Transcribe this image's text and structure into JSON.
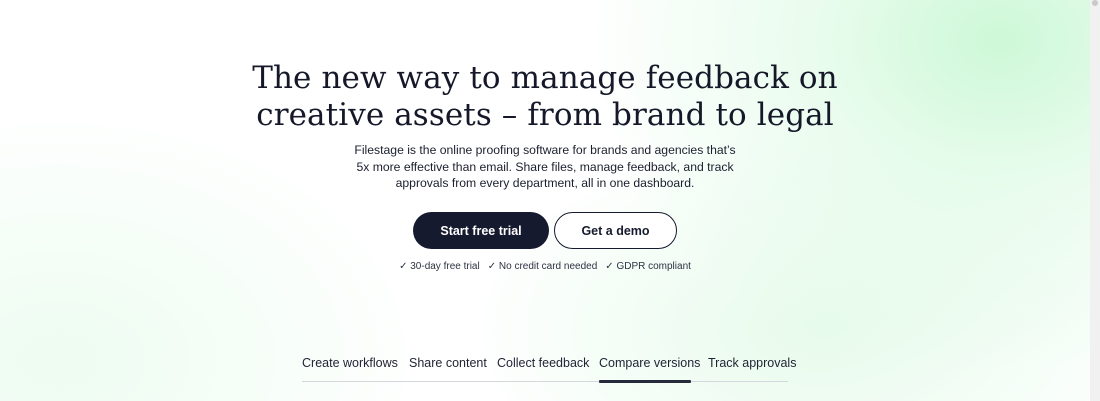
{
  "hero": {
    "title_line1": "The new way to manage feedback on",
    "title_line2": "creative assets – from brand to legal",
    "subtitle_line1": "Filestage is the online proofing software for brands and agencies that’s",
    "subtitle_line2": "5x more effective than email. Share files, manage feedback, and track",
    "subtitle_line3": "approvals from every department, all in one dashboard."
  },
  "cta": {
    "primary_label": "Start free trial",
    "secondary_label": "Get a demo"
  },
  "perks": [
    "✓ 30-day free trial",
    "✓ No credit card needed",
    "✓ GDPR compliant"
  ],
  "tabs": [
    {
      "label": "Create workflows",
      "active": false
    },
    {
      "label": "Share content",
      "active": false
    },
    {
      "label": "Collect feedback",
      "active": false
    },
    {
      "label": "Compare versions",
      "active": true
    },
    {
      "label": "Track approvals",
      "active": false
    }
  ],
  "colors": {
    "primary": "#161a2e",
    "accent_glow": "#c4f7d0",
    "text": "#151829"
  }
}
